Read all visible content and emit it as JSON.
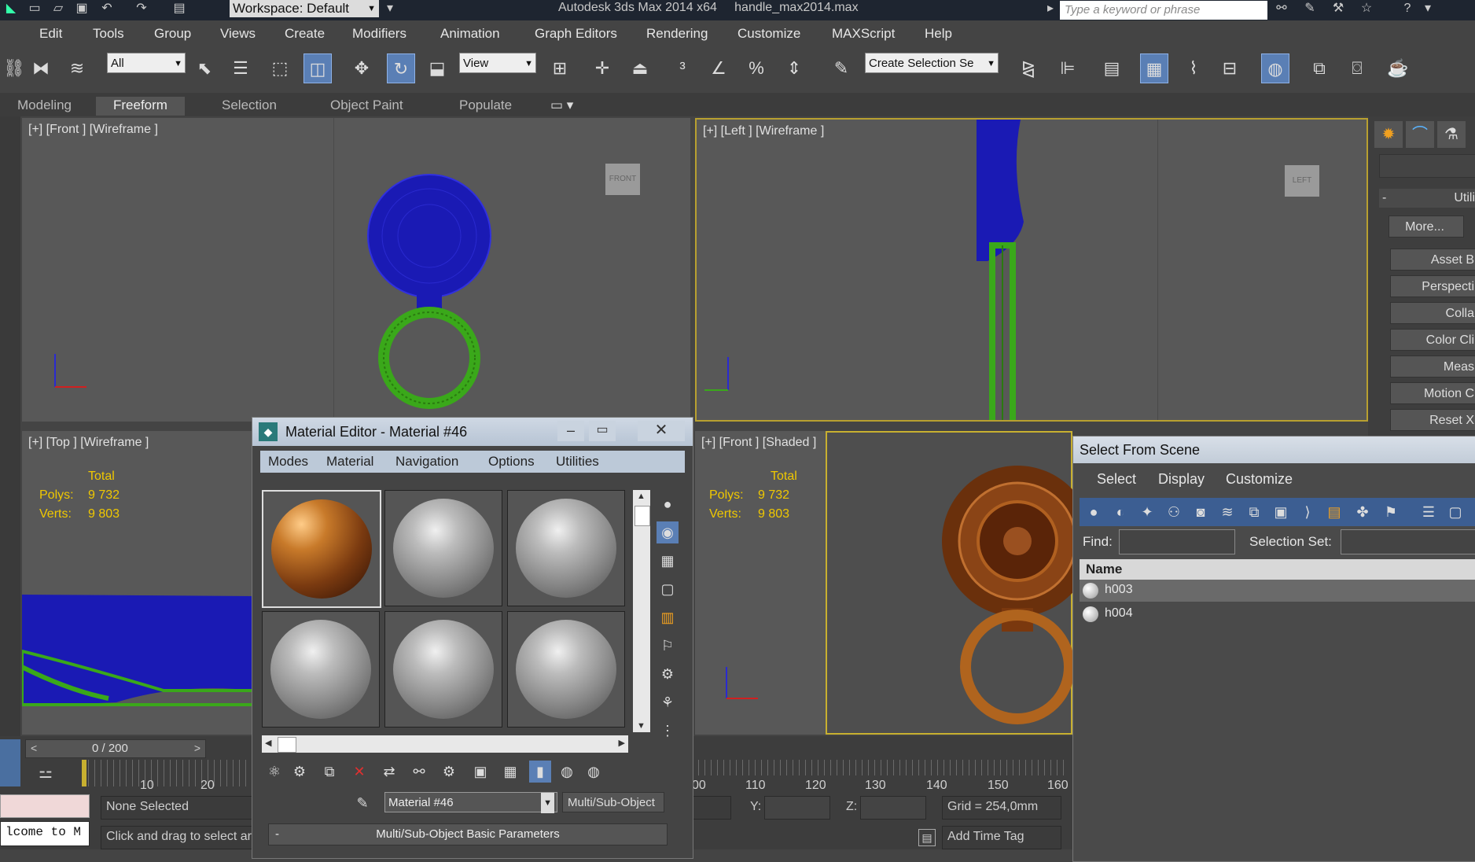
{
  "titlebar": {
    "workspace": "Workspace: Default",
    "app_title": "Autodesk 3ds Max  2014 x64",
    "file_name": "handle_max2014.max",
    "search_placeholder": "Type a keyword or phrase"
  },
  "menu": [
    "Edit",
    "Tools",
    "Group",
    "Views",
    "Create",
    "Modifiers",
    "Animation",
    "Graph Editors",
    "Rendering",
    "Customize",
    "MAXScript",
    "Help"
  ],
  "toolbar": {
    "filter_value": "All",
    "ref_coord_value": "View",
    "selection_set_value": "Create Selection Se"
  },
  "ribbon_tabs": [
    "Modeling",
    "Freeform",
    "Selection",
    "Object Paint",
    "Populate"
  ],
  "ribbon_selected": "Freeform",
  "viewports": {
    "front_wire": "[+] [Front ] [Wireframe ]",
    "left_wire": "[+] [Left ] [Wireframe ]",
    "top_wire": "[+] [Top ] [Wireframe ]",
    "front_shaded": "[+] [Front ] [Shaded ]",
    "viewcube_front": "FRONT",
    "viewcube_left": "LEFT"
  },
  "stats": {
    "total": "Total",
    "polys_label": "Polys:",
    "polys_value": "9 732",
    "verts_label": "Verts:",
    "verts_value": "9 803"
  },
  "material_editor": {
    "title": "Material Editor - Material #46",
    "menu": [
      "Modes",
      "Material",
      "Navigation",
      "Options",
      "Utilities"
    ],
    "material_name": "Material #46",
    "material_type": "Multi/Sub-Object",
    "rollout": "Multi/Sub-Object Basic Parameters"
  },
  "select_from_scene": {
    "title": "Select From Scene",
    "menu": [
      "Select",
      "Display",
      "Customize"
    ],
    "find_label": "Find:",
    "selection_set_label": "Selection Set:",
    "column_name": "Name",
    "rows": [
      "h003",
      "h004"
    ]
  },
  "command_panel": {
    "header": "Utili",
    "more": "More...",
    "buttons": [
      "Asset B",
      "Perspecti",
      "Colla",
      "Color Cli",
      "Meas",
      "Motion C",
      "Reset X"
    ]
  },
  "timeline": {
    "frame": "0 / 200",
    "ticks_left": [
      "10",
      "20"
    ],
    "ticks_right": [
      "00",
      "110",
      "120",
      "130",
      "140",
      "150",
      "160"
    ]
  },
  "status": {
    "none_selected": "None Selected",
    "prompt": "Click and drag to select ar",
    "listener": "lcome to M",
    "y_label": "Y:",
    "z_label": "Z:",
    "grid": "Grid = 254,0mm",
    "add_time_tag": "Add Time Tag"
  },
  "colors": {
    "accent_active": "#5a7fb5",
    "wire_blue": "#1a1ab4",
    "wire_green": "#3aa81a",
    "copper": "#b0641e",
    "stats_yellow": "#f0c800"
  }
}
